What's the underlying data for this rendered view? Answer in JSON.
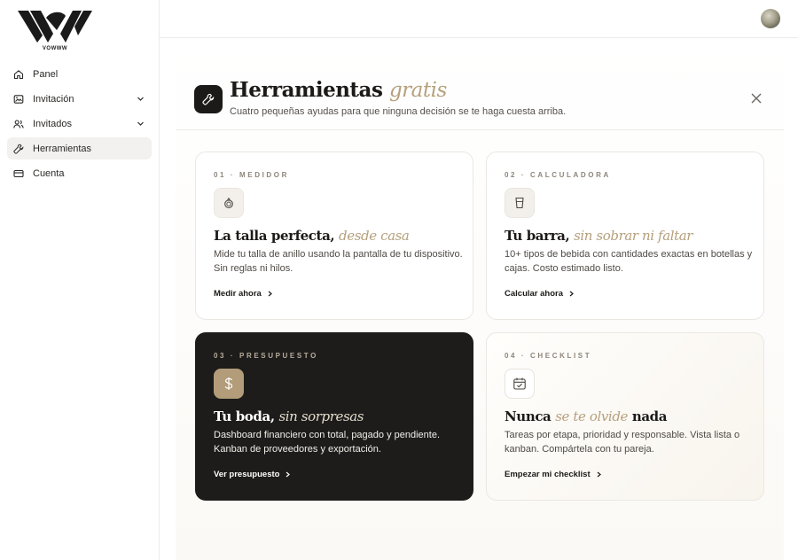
{
  "brand": {
    "logo_text": "VOWWW"
  },
  "sidebar": {
    "items": [
      {
        "label": "Panel",
        "icon": "home-icon",
        "active": false,
        "expandable": false
      },
      {
        "label": "Invitación",
        "icon": "invitation-icon",
        "active": false,
        "expandable": true
      },
      {
        "label": "Invitados",
        "icon": "users-icon",
        "active": false,
        "expandable": true
      },
      {
        "label": "Herramientas",
        "icon": "tools-icon",
        "active": true,
        "expandable": false
      },
      {
        "label": "Cuenta",
        "icon": "card-icon",
        "active": false,
        "expandable": false
      }
    ]
  },
  "header": {
    "title_main": "Herramientas",
    "title_accent": "gratis",
    "subtitle": "Cuatro pequeñas ayudas para que ninguna decisión se te haga cuesta arriba.",
    "close_icon": "close-icon"
  },
  "colors": {
    "accent": "#b5a07c",
    "dark": "#1d1c1b",
    "gold_icon_bg": "#b29c79"
  },
  "cards": [
    {
      "eyebrow": "01 · MEDIDOR",
      "icon": "ring-icon",
      "title_bold": "La talla perfecta,",
      "title_italic": "desde casa",
      "description": "Mide tu talla de anillo usando la pantalla de tu dispositivo. Sin reglas ni hilos.",
      "cta": "Medir ahora"
    },
    {
      "eyebrow": "02 · CALCULADORA",
      "icon": "glass-icon",
      "title_bold": "Tu barra,",
      "title_italic": "sin sobrar ni faltar",
      "description": "10+ tipos de bebida con cantidades exactas en botellas y cajas. Costo estimado listo.",
      "cta": "Calcular ahora"
    },
    {
      "eyebrow": "03 · PRESUPUESTO",
      "icon": "dollar-icon",
      "title_bold": "Tu boda,",
      "title_italic": "sin sorpresas",
      "description": "Dashboard financiero con total, pagado y pendiente. Kanban de proveedores y exportación.",
      "cta": "Ver presupuesto"
    },
    {
      "eyebrow": "04 · CHECKLIST",
      "icon": "calendar-check-icon",
      "title_bold": "Nunca",
      "title_italic": "se te olvide",
      "title_bold_after": "nada",
      "description": "Tareas por etapa, prioridad y responsable. Vista lista o kanban. Compártela con tu pareja.",
      "cta": "Empezar mi checklist"
    }
  ]
}
